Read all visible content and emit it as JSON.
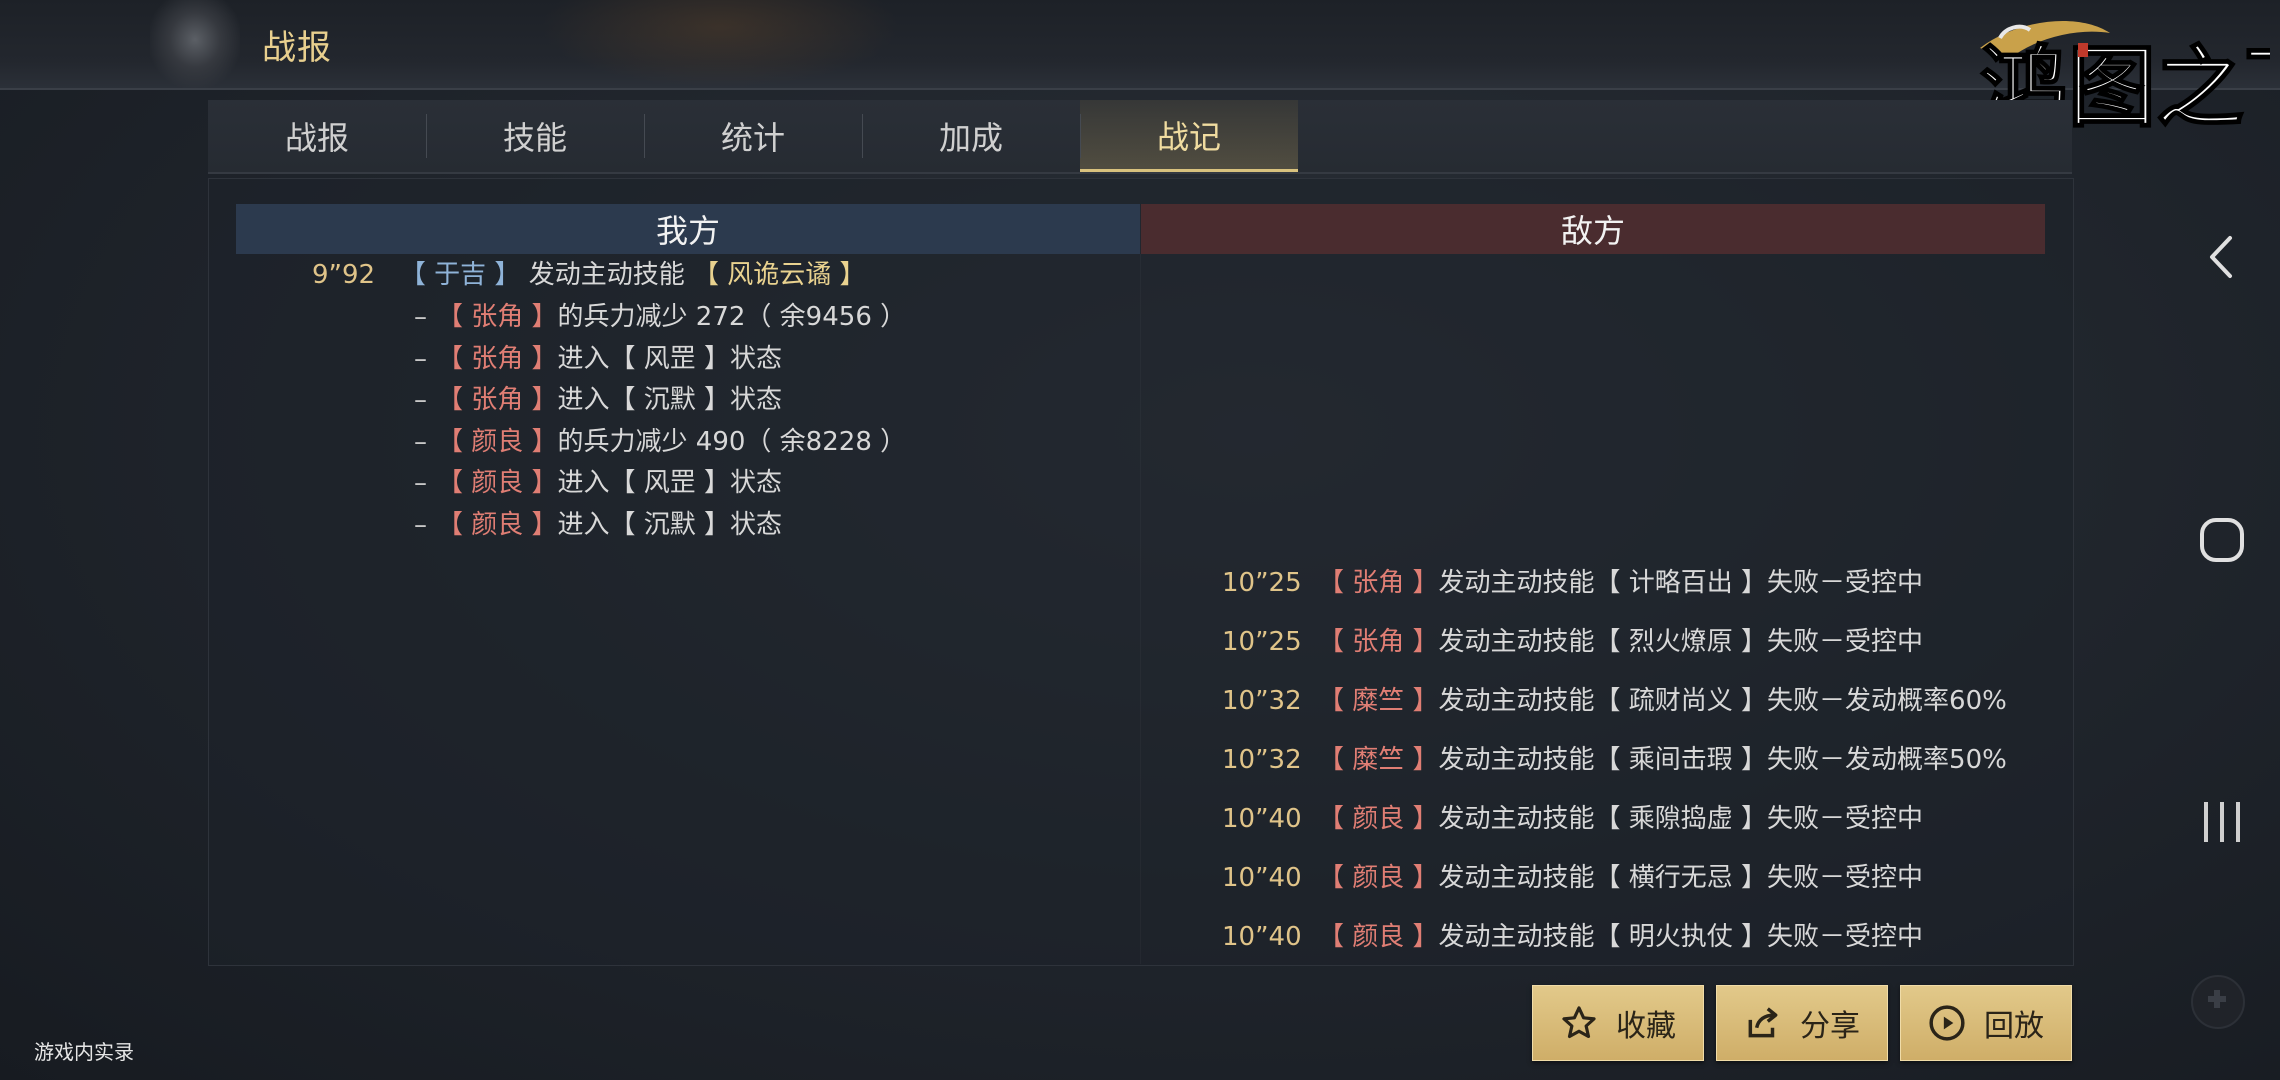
{
  "header": {
    "title": "战报",
    "logo_text": "鸿图之下"
  },
  "tabs": [
    {
      "label": "战报",
      "active": false
    },
    {
      "label": "技能",
      "active": false
    },
    {
      "label": "统计",
      "active": false
    },
    {
      "label": "加成",
      "active": false
    },
    {
      "label": "战记",
      "active": true
    }
  ],
  "columns": {
    "ours": "我方",
    "enemy": "敌方"
  },
  "ally_log": {
    "time": "9”92",
    "actor": "【 于吉 】",
    "action": "发动主动技能",
    "skill": "【 风诡云谲 】",
    "effects": [
      {
        "target": "【 张角 】",
        "text": "的兵力减少 272（ 余9456 ）"
      },
      {
        "target": "【 张角 】",
        "text": "进入【 风罡 】状态"
      },
      {
        "target": "【 张角 】",
        "text": "进入【 沉默 】状态"
      },
      {
        "target": "【 颜良 】",
        "text": "的兵力减少 490（ 余8228 ）"
      },
      {
        "target": "【 颜良 】",
        "text": "进入【 风罡 】状态"
      },
      {
        "target": "【 颜良 】",
        "text": "进入【 沉默 】状态"
      }
    ]
  },
  "enemy_log": [
    {
      "time": "10”25",
      "actor": "【 张角 】",
      "action": "发动主动技能【 计略百出 】失败－受控中"
    },
    {
      "time": "10”25",
      "actor": "【 张角 】",
      "action": "发动主动技能【 烈火燎原 】失败－受控中"
    },
    {
      "time": "10”32",
      "actor": "【 糜竺 】",
      "action": "发动主动技能【 疏财尚义 】失败－发动概率60%"
    },
    {
      "time": "10”32",
      "actor": "【 糜竺 】",
      "action": "发动主动技能【 乘间击瑕 】失败－发动概率50%"
    },
    {
      "time": "10”40",
      "actor": "【 颜良 】",
      "action": "发动主动技能【 乘隙捣虚 】失败－受控中"
    },
    {
      "time": "10”40",
      "actor": "【 颜良 】",
      "action": "发动主动技能【 横行无忌 】失败－受控中"
    },
    {
      "time": "10”40",
      "actor": "【 颜良 】",
      "action": "发动主动技能【 明火执仗 】失败－受控中"
    }
  ],
  "buttons": {
    "favorite": "收藏",
    "share": "分享",
    "replay": "回放"
  },
  "footer_note": "游戏内实录",
  "colors": {
    "accent_gold": "#e0c489",
    "ally_name": "#8fb3d8",
    "enemy_name": "#e07e74",
    "button_bg": "#d8bb78"
  },
  "icons": [
    "star-icon",
    "share-icon",
    "play-icon",
    "back-icon",
    "home-icon",
    "recents-icon",
    "gamepad-icon"
  ]
}
